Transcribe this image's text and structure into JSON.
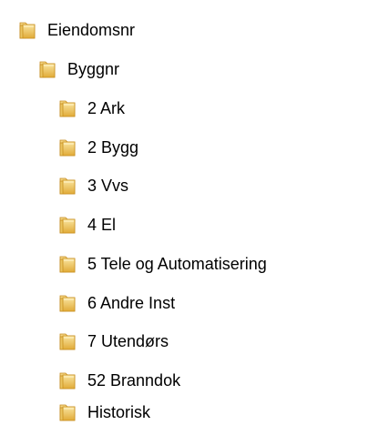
{
  "tree": {
    "icon": "folder-icon",
    "folder_color": "#e8b84a",
    "items": [
      {
        "label": "Eiendomsnr",
        "level": 0
      },
      {
        "label": "Byggnr",
        "level": 1
      },
      {
        "label": "2 Ark",
        "level": 2
      },
      {
        "label": "2 Bygg",
        "level": 2
      },
      {
        "label": "3 Vvs",
        "level": 2
      },
      {
        "label": "4 El",
        "level": 2
      },
      {
        "label": "5 Tele og Automatisering",
        "level": 2
      },
      {
        "label": "6 Andre Inst",
        "level": 2
      },
      {
        "label": "7 Utendørs",
        "level": 2
      },
      {
        "label": "52 Branndok",
        "level": 2
      },
      {
        "label": "Historisk",
        "level": 2
      }
    ]
  }
}
